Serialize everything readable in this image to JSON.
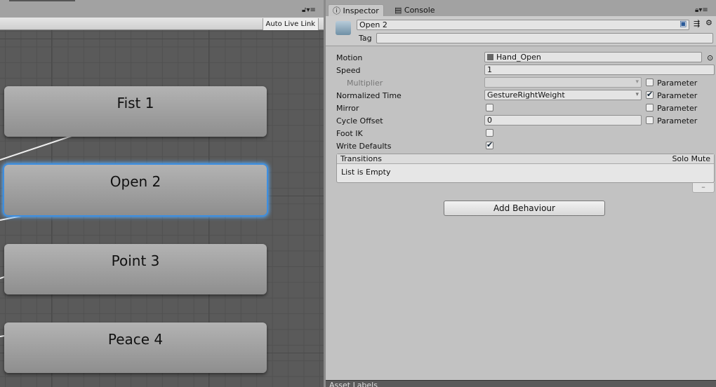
{
  "graph": {
    "auto_live_link": "Auto Live Link",
    "nodes": [
      {
        "label": "Fist 1",
        "selected": false
      },
      {
        "label": "Open 2",
        "selected": true
      },
      {
        "label": "Point 3",
        "selected": false
      },
      {
        "label": "Peace 4",
        "selected": false
      }
    ],
    "selection_color": "#3d8ee0"
  },
  "tabs": [
    {
      "label": "Inspector",
      "icon": "info-icon",
      "active": true
    },
    {
      "label": "Console",
      "icon": "console-icon",
      "active": false
    }
  ],
  "header": {
    "name": "Open 2",
    "tag_label": "Tag",
    "tag_value": ""
  },
  "props": {
    "motion_label": "Motion",
    "motion_value": "Hand_Open",
    "speed_label": "Speed",
    "speed_value": "1",
    "multiplier_label": "Multiplier",
    "multiplier_value": "",
    "normtime_label": "Normalized Time",
    "normtime_value": "GestureRightWeight",
    "mirror_label": "Mirror",
    "cycle_label": "Cycle Offset",
    "cycle_value": "0",
    "footik_label": "Foot IK",
    "writedef_label": "Write Defaults",
    "parameter": "Parameter",
    "multiplier_param": false,
    "normtime_param": true,
    "mirror_param": false,
    "cycle_param": false,
    "mirror": false,
    "footik": false,
    "writedef": true
  },
  "transitions": {
    "title": "Transitions",
    "solo": "Solo",
    "mute": "Mute",
    "empty": "List is Empty",
    "remove": "–"
  },
  "add_behaviour": "Add Behaviour",
  "asset_labels": "Asset Labels"
}
